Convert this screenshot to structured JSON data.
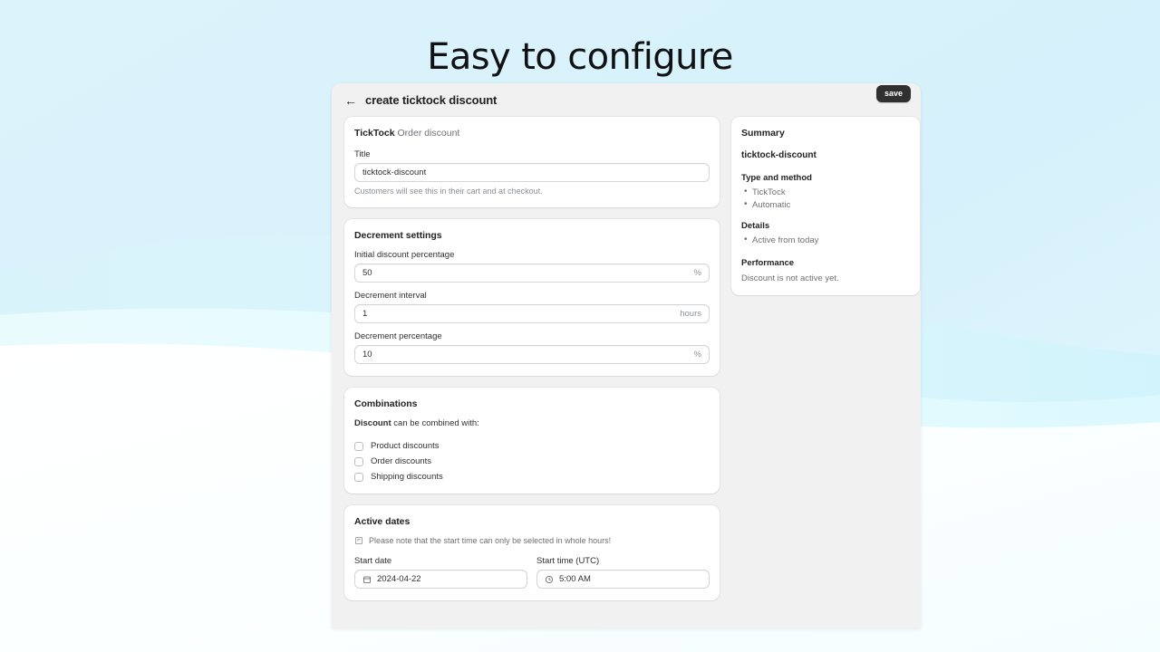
{
  "hero": {
    "title": "Easy to configure"
  },
  "theme": {
    "background_top": "#dbf3fb",
    "wave_light": "#e9fbfe",
    "wave_white": "#ffffff",
    "panel_bg": "#f1f1f1",
    "save_button_bg": "#303030",
    "text_primary": "#202223",
    "text_muted": "#6d7175"
  },
  "app": {
    "topbar": {
      "back_icon": "arrow-left-icon",
      "title": "create ticktock discount",
      "save_label": "save"
    },
    "method_card": {
      "eyebrow_strong": "TickTock",
      "eyebrow_rest": "Order discount",
      "title_label": "Title",
      "title_value": "ticktock-discount",
      "title_placeholder": "ticktock-discount",
      "help_text": "Customers will see this in their cart and at checkout."
    },
    "decrement_card": {
      "heading": "Decrement settings",
      "fields": [
        {
          "label": "Initial discount percentage",
          "value": "50",
          "suffix": "%"
        },
        {
          "label": "Decrement interval",
          "value": "1",
          "suffix": "hours"
        },
        {
          "label": "Decrement percentage",
          "value": "10",
          "suffix": "%"
        }
      ]
    },
    "combinations_card": {
      "heading": "Combinations",
      "line_strong": "Discount",
      "line_rest": "can be combined with:",
      "options": [
        {
          "label": "Product discounts",
          "checked": false
        },
        {
          "label": "Order discounts",
          "checked": false
        },
        {
          "label": "Shipping discounts",
          "checked": false
        }
      ]
    },
    "active_dates_card": {
      "heading": "Active dates",
      "note_icon": "note-icon",
      "note": "Please note that the start time can only be selected in whole hours!",
      "start_date_label": "Start date",
      "start_date_value": "2024-04-22",
      "start_date_icon": "calendar-icon",
      "start_time_label": "Start time (UTC)",
      "start_time_value": "5:00 AM",
      "start_time_icon": "clock-icon"
    },
    "summary_card": {
      "heading": "Summary",
      "discount_name": "ticktock-discount",
      "type_heading": "Type and method",
      "type_items": [
        "TickTock",
        "Automatic"
      ],
      "details_heading": "Details",
      "details_items": [
        "Active from today"
      ],
      "performance_heading": "Performance",
      "performance_text": "Discount is not active yet."
    }
  }
}
